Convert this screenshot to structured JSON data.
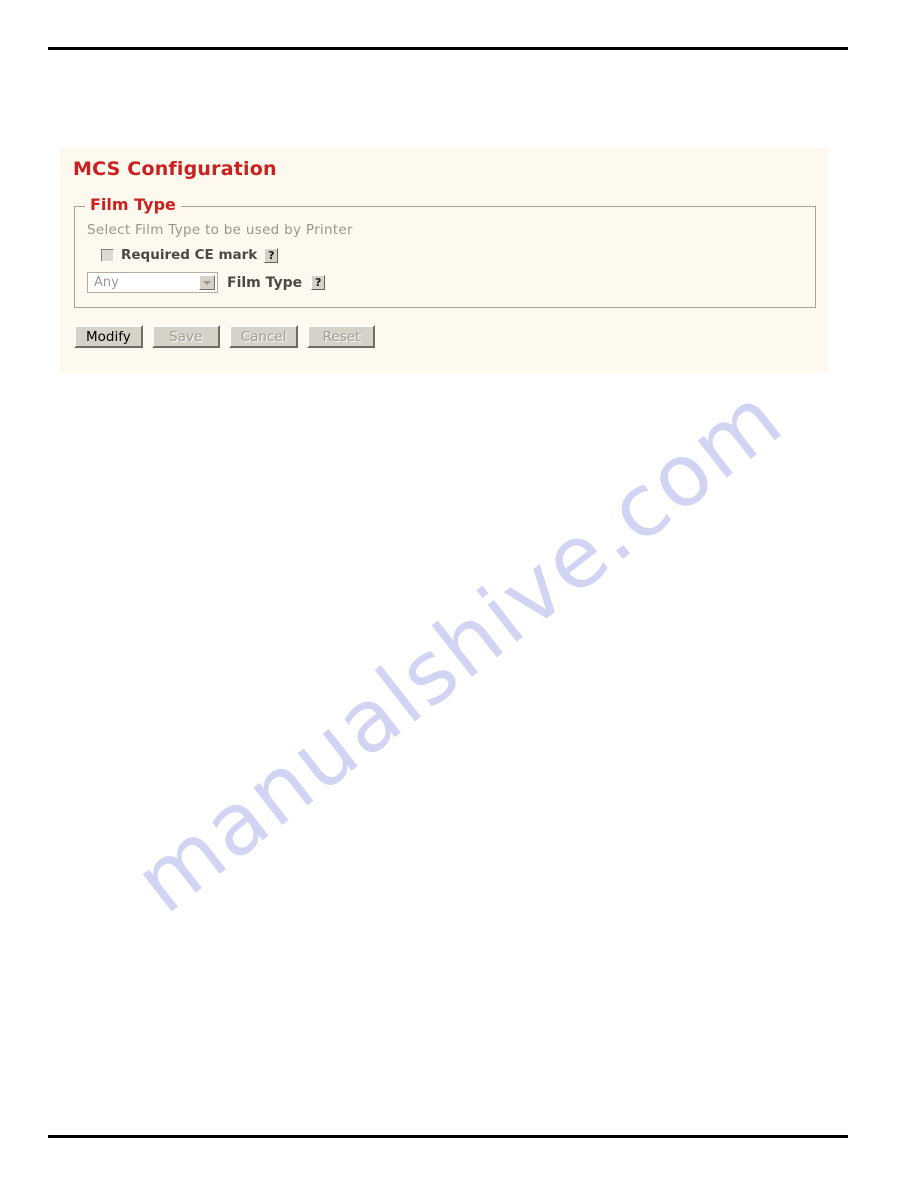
{
  "page": {
    "title": "MCS Configuration",
    "watermark": "manualshive.com"
  },
  "fieldset": {
    "legend": "Film Type",
    "description": "Select Film Type to be used by Printer"
  },
  "form": {
    "ce_mark": {
      "label": "Required CE mark",
      "checked": false,
      "help_icon": "?"
    },
    "film_type": {
      "label": "Film Type",
      "selected_value": "Any",
      "help_icon": "?"
    }
  },
  "buttons": {
    "modify": "Modify",
    "save": "Save",
    "cancel": "Cancel",
    "reset": "Reset"
  },
  "colors": {
    "heading": "#cc1f1f",
    "panel_background": "#fdf9ee",
    "watermark": "#c9cdf2",
    "button_face": "#d6d2c8"
  }
}
